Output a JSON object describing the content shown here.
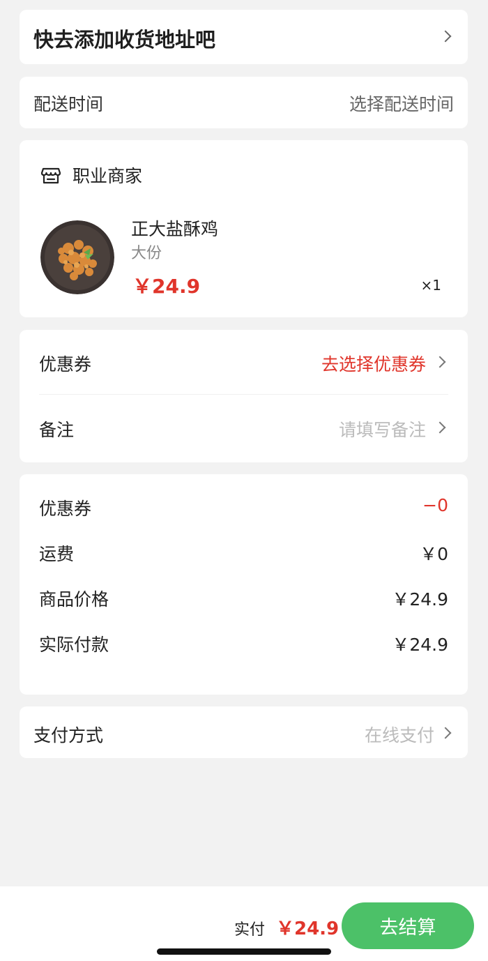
{
  "address": {
    "prompt": "快去添加收货地址吧"
  },
  "delivery": {
    "label": "配送时间",
    "value": "选择配送时间"
  },
  "store": {
    "name": "职业商家",
    "item": {
      "name": "正大盐酥鸡",
      "spec": "大份",
      "price": "￥24.9",
      "qty": "×1"
    }
  },
  "options": {
    "coupon": {
      "label": "优惠券",
      "value": "去选择优惠券"
    },
    "remark": {
      "label": "备注",
      "placeholder": "请填写备注"
    }
  },
  "summary": {
    "coupon": {
      "label": "优惠券",
      "value": "−0"
    },
    "shipping": {
      "label": "运费",
      "value": "￥0"
    },
    "goods": {
      "label": "商品价格",
      "value": "￥24.9"
    },
    "actual": {
      "label": "实际付款",
      "value": "￥24.9"
    }
  },
  "payment": {
    "label": "支付方式",
    "value": "在线支付"
  },
  "bottom_bar": {
    "pay_label": "实付",
    "pay_amount": "￥24.9",
    "checkout_label": "去结算"
  },
  "colors": {
    "accent_red": "#e0352b",
    "checkout_green": "#4cc168",
    "background": "#f2f2f2"
  },
  "icons": {
    "store": "store-icon",
    "chevron": "chevron-right-icon"
  }
}
